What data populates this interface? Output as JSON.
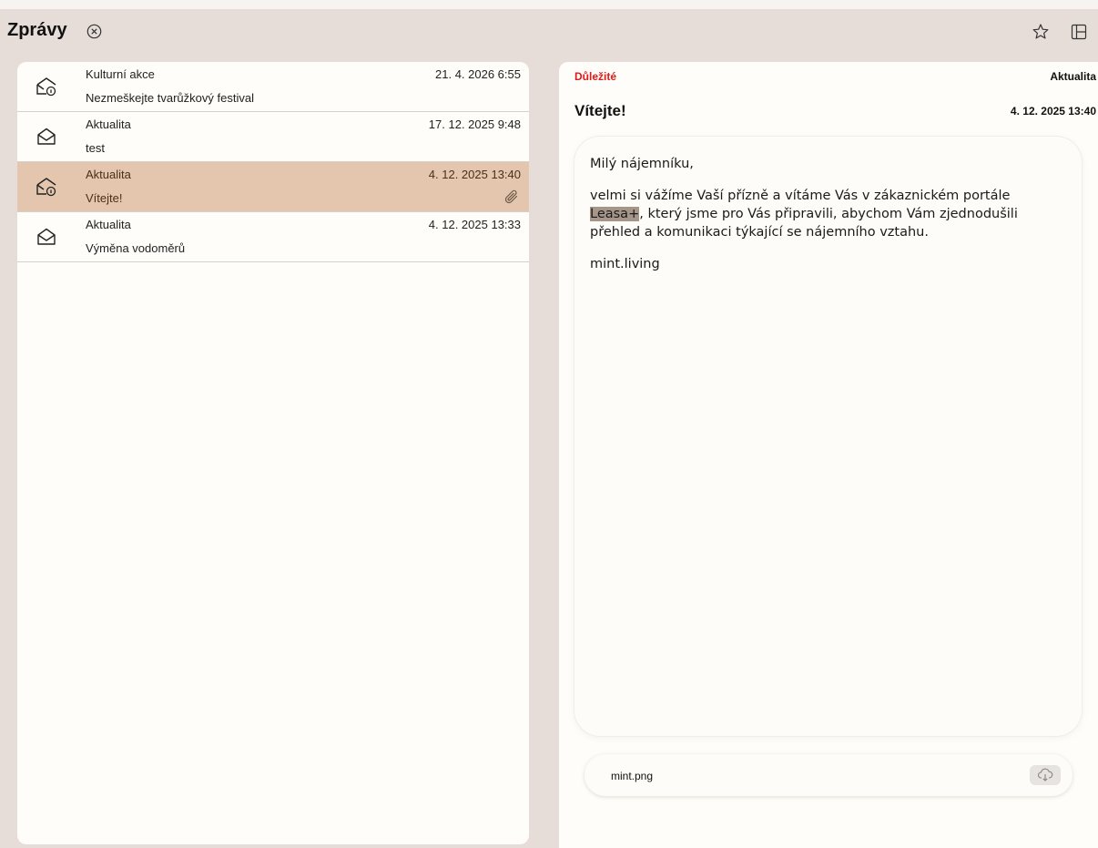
{
  "header": {
    "title": "Zprávy"
  },
  "messages": [
    {
      "category": "Kulturní akce",
      "subject": "Nezmeškejte tvarůžkový festival",
      "date": "21. 4. 2026 6:55",
      "icon": "envelope-info-icon",
      "selected": false,
      "attachment": false
    },
    {
      "category": "Aktualita",
      "subject": "test",
      "date": "17. 12. 2025 9:48",
      "icon": "envelope-open-icon",
      "selected": false,
      "attachment": false
    },
    {
      "category": "Aktualita",
      "subject": "Vítejte!",
      "date": "4. 12. 2025 13:40",
      "icon": "envelope-info-icon",
      "selected": true,
      "attachment": true
    },
    {
      "category": "Aktualita",
      "subject": "Výměna vodoměrů",
      "date": "4. 12. 2025 13:33",
      "icon": "envelope-open-icon",
      "selected": false,
      "attachment": false
    }
  ],
  "detail": {
    "importance": "Důležité",
    "category": "Aktualita",
    "title": "Vítejte!",
    "date": "4. 12. 2025 13:40",
    "greeting": "Milý nájemníku,",
    "para_before": "velmi si vážíme Vaší přízně a vítáme Vás v zákaznickém portále ",
    "highlight": "Leasa+",
    "para_after": ", který jsme pro Vás připravili, abychom Vám zjednodušili přehled a komunikaci týkající se nájemního vztahu.",
    "signature": "mint.living",
    "attachment": {
      "filename": "mint.png"
    }
  },
  "colors": {
    "important": "#e01a1a",
    "selected_row": "#e3c6ad",
    "background": "#e6ddd8"
  }
}
